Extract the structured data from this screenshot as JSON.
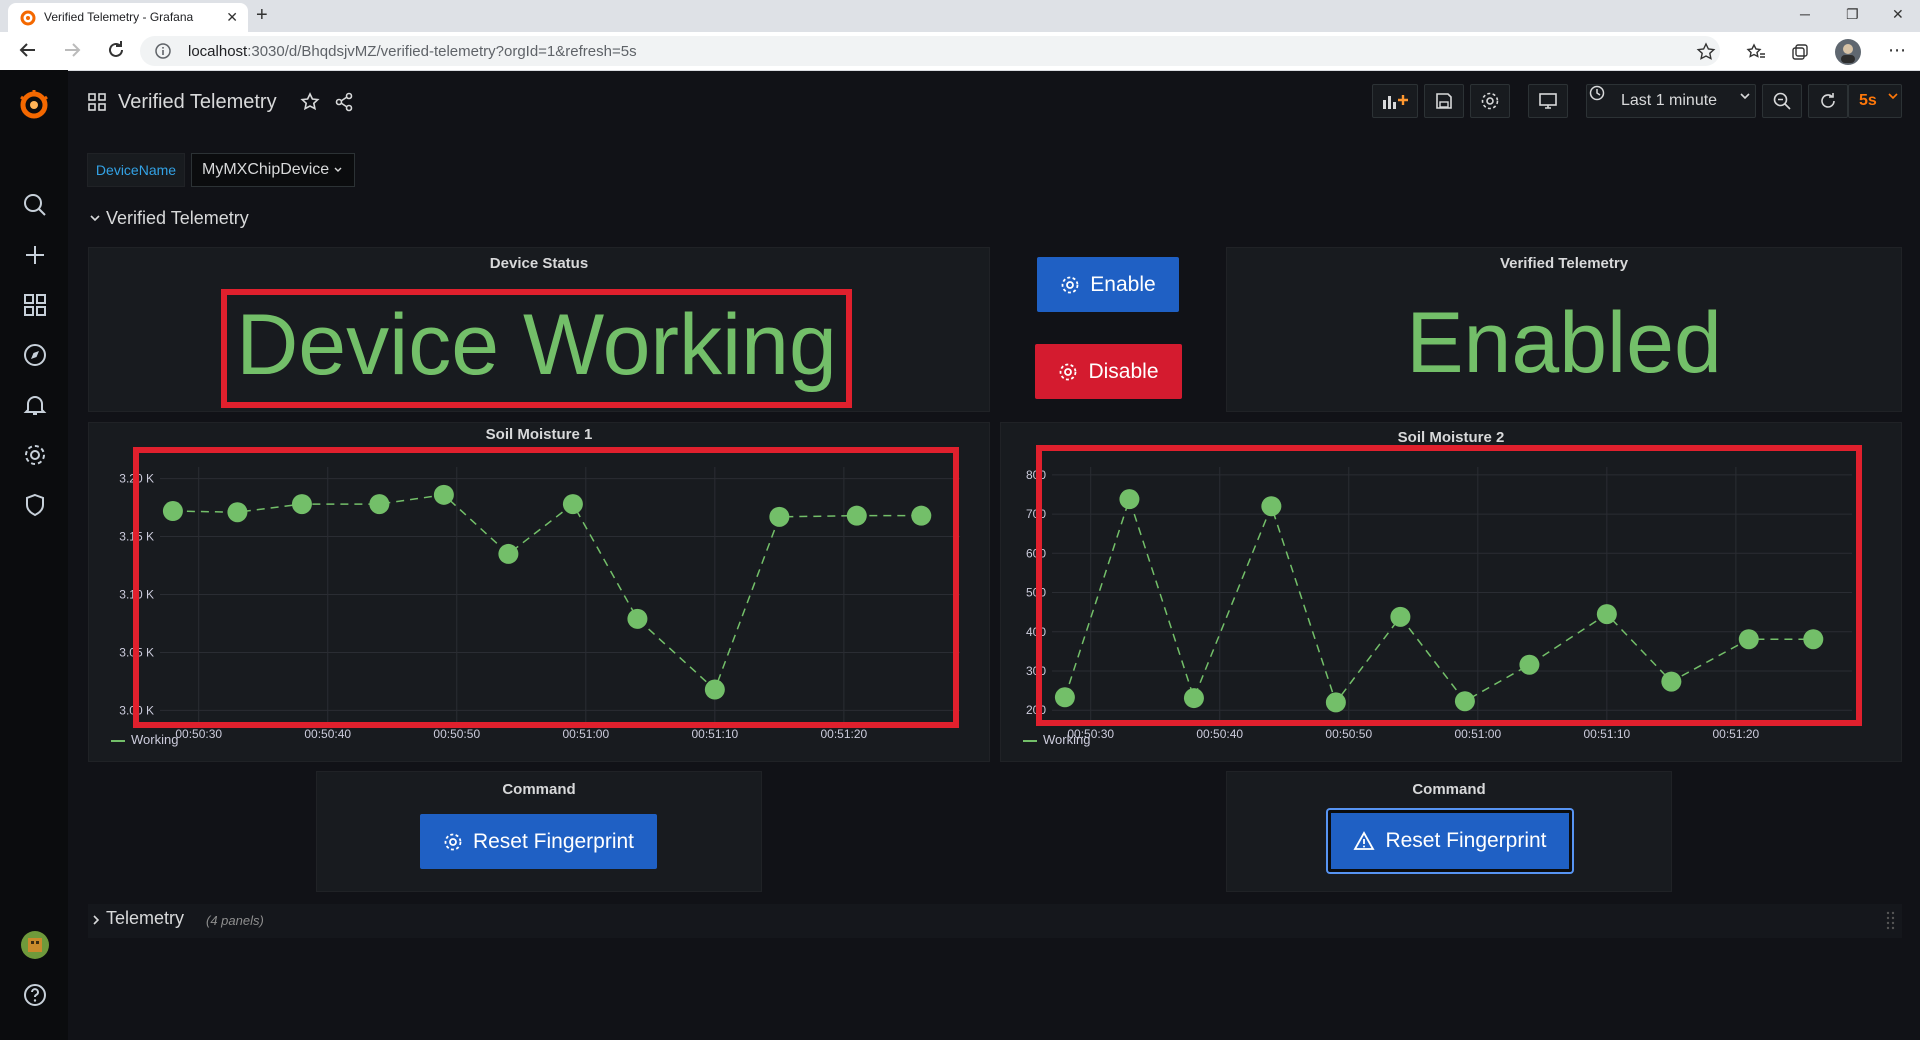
{
  "browser": {
    "tab_title": "Verified Telemetry - Grafana",
    "tab_close": "✕",
    "new_tab": "+",
    "url_host": "localhost",
    "url_rest": ":3030/d/BhqdsjvMZ/verified-telemetry?orgId=1&refresh=5s",
    "window_min": "─",
    "window_max": "❐",
    "window_close": "✕"
  },
  "dashboard": {
    "title": "Verified Telemetry",
    "time_range": "Last 1 minute",
    "refresh": "5s"
  },
  "variable": {
    "label": "DeviceName",
    "value": "MyMXChipDevice"
  },
  "row_verified": {
    "title": "Verified Telemetry"
  },
  "device_status": {
    "title": "Device Status",
    "value": "Device Working"
  },
  "buttons": {
    "enable": "Enable",
    "disable": "Disable"
  },
  "verified_panel": {
    "title": "Verified Telemetry",
    "value": "Enabled"
  },
  "soil1": {
    "title": "Soil Moisture 1",
    "legend": "Working"
  },
  "soil2": {
    "title": "Soil Moisture 2",
    "legend": "Working"
  },
  "command1": {
    "title": "Command",
    "button": "Reset Fingerprint"
  },
  "command2": {
    "title": "Command",
    "button": "Reset Fingerprint"
  },
  "row_telemetry": {
    "title": "Telemetry",
    "count": "(4 panels)"
  },
  "colors": {
    "green": "#73bf69",
    "blue": "#1f60c4",
    "red": "#d41b2f",
    "orange": "#ff780a"
  },
  "chart_data": [
    {
      "type": "line",
      "title": "Soil Moisture 1",
      "x": [
        "00:50:28",
        "00:50:33",
        "00:50:38",
        "00:50:44",
        "00:50:49",
        "00:50:54",
        "00:50:59",
        "00:51:04",
        "00:51:10",
        "00:51:15",
        "00:51:21",
        "00:51:26"
      ],
      "series": [
        {
          "name": "Working",
          "values": [
            3.172,
            3.171,
            3.178,
            3.178,
            3.186,
            3.135,
            3.178,
            3.079,
            3.018,
            3.167,
            3.168,
            3.168
          ]
        }
      ],
      "tick_labels": [
        "00:50:30",
        "00:50:40",
        "00:50:50",
        "00:51:00",
        "00:51:10",
        "00:51:20"
      ],
      "y_ticks": [
        "3.00 K",
        "3.05 K",
        "3.10 K",
        "3.15 K",
        "3.20 K"
      ],
      "xlim": [
        "00:50:27",
        "00:51:29"
      ],
      "ylim": [
        2.99,
        3.21
      ],
      "grid": true
    },
    {
      "type": "line",
      "title": "Soil Moisture 2",
      "x": [
        "00:50:28",
        "00:50:33",
        "00:50:38",
        "00:50:44",
        "00:50:49",
        "00:50:54",
        "00:50:59",
        "00:51:04",
        "00:51:10",
        "00:51:15",
        "00:51:21",
        "00:51:26"
      ],
      "series": [
        {
          "name": "Working",
          "values": [
            233,
            738,
            231,
            720,
            220,
            438,
            223,
            316,
            445,
            273,
            381,
            381
          ]
        }
      ],
      "tick_labels": [
        "00:50:30",
        "00:50:40",
        "00:50:50",
        "00:51:00",
        "00:51:10",
        "00:51:20"
      ],
      "y_ticks": [
        "200",
        "300",
        "400",
        "500",
        "600",
        "700",
        "800"
      ],
      "xlim": [
        "00:50:27",
        "00:51:29"
      ],
      "ylim": [
        170,
        820
      ],
      "grid": true
    }
  ]
}
